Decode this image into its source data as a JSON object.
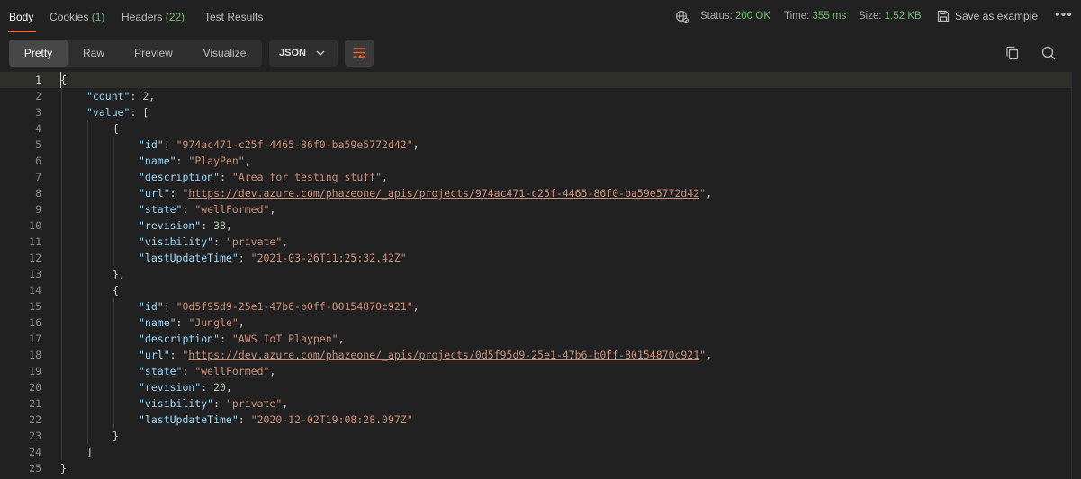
{
  "response_tabs": [
    {
      "label": "Body",
      "count": ""
    },
    {
      "label": "Cookies",
      "count": "(1)"
    },
    {
      "label": "Headers",
      "count": "(22)"
    },
    {
      "label": "Test Results",
      "count": ""
    }
  ],
  "status": {
    "status_label": "Status:",
    "status_value": "200 OK",
    "time_label": "Time:",
    "time_value": "355 ms",
    "size_label": "Size:",
    "size_value": "1.52 KB"
  },
  "save_example_label": "Save as example",
  "view_modes": [
    "Pretty",
    "Raw",
    "Preview",
    "Visualize"
  ],
  "format_select": "JSON",
  "colors": {
    "accent": "#ff6c37",
    "success": "#6fbf73",
    "key": "#9cdcfe",
    "string": "#ce9178",
    "number": "#b5cea8"
  },
  "icons": {
    "network": "globe-icon",
    "save": "save-icon",
    "more": "more-icon",
    "wrap": "wrap-lines-icon",
    "copy": "copy-icon",
    "search": "search-icon",
    "dropdown": "chevron-down-icon"
  },
  "code_lines": [
    {
      "n": "1",
      "ind": 0,
      "tok": [
        [
          "p",
          "{"
        ]
      ]
    },
    {
      "n": "2",
      "ind": 1,
      "tok": [
        [
          "k",
          "\"count\""
        ],
        [
          "p",
          ": "
        ],
        [
          "n",
          "2"
        ],
        [
          "p",
          ","
        ]
      ]
    },
    {
      "n": "3",
      "ind": 1,
      "tok": [
        [
          "k",
          "\"value\""
        ],
        [
          "p",
          ": ["
        ]
      ]
    },
    {
      "n": "4",
      "ind": 2,
      "tok": [
        [
          "p",
          "{"
        ]
      ]
    },
    {
      "n": "5",
      "ind": 3,
      "tok": [
        [
          "k",
          "\"id\""
        ],
        [
          "p",
          ": "
        ],
        [
          "s",
          "\"974ac471-c25f-4465-86f0-ba59e5772d42\""
        ],
        [
          "p",
          ","
        ]
      ]
    },
    {
      "n": "6",
      "ind": 3,
      "tok": [
        [
          "k",
          "\"name\""
        ],
        [
          "p",
          ": "
        ],
        [
          "s",
          "\"PlayPen\""
        ],
        [
          "p",
          ","
        ]
      ]
    },
    {
      "n": "7",
      "ind": 3,
      "tok": [
        [
          "k",
          "\"description\""
        ],
        [
          "p",
          ": "
        ],
        [
          "s",
          "\"Area for testing stuff\""
        ],
        [
          "p",
          ","
        ]
      ]
    },
    {
      "n": "8",
      "ind": 3,
      "tok": [
        [
          "k",
          "\"url\""
        ],
        [
          "p",
          ": "
        ],
        [
          "s",
          "\""
        ],
        [
          "u",
          "https://dev.azure.com/phazeone/_apis/projects/974ac471-c25f-4465-86f0-ba59e5772d42"
        ],
        [
          "s",
          "\""
        ],
        [
          "p",
          ","
        ]
      ]
    },
    {
      "n": "9",
      "ind": 3,
      "tok": [
        [
          "k",
          "\"state\""
        ],
        [
          "p",
          ": "
        ],
        [
          "s",
          "\"wellFormed\""
        ],
        [
          "p",
          ","
        ]
      ]
    },
    {
      "n": "10",
      "ind": 3,
      "tok": [
        [
          "k",
          "\"revision\""
        ],
        [
          "p",
          ": "
        ],
        [
          "n",
          "38"
        ],
        [
          "p",
          ","
        ]
      ]
    },
    {
      "n": "11",
      "ind": 3,
      "tok": [
        [
          "k",
          "\"visibility\""
        ],
        [
          "p",
          ": "
        ],
        [
          "s",
          "\"private\""
        ],
        [
          "p",
          ","
        ]
      ]
    },
    {
      "n": "12",
      "ind": 3,
      "tok": [
        [
          "k",
          "\"lastUpdateTime\""
        ],
        [
          "p",
          ": "
        ],
        [
          "s",
          "\"2021-03-26T11:25:32.42Z\""
        ]
      ]
    },
    {
      "n": "13",
      "ind": 2,
      "tok": [
        [
          "p",
          "},"
        ]
      ]
    },
    {
      "n": "14",
      "ind": 2,
      "tok": [
        [
          "p",
          "{"
        ]
      ]
    },
    {
      "n": "15",
      "ind": 3,
      "tok": [
        [
          "k",
          "\"id\""
        ],
        [
          "p",
          ": "
        ],
        [
          "s",
          "\"0d5f95d9-25e1-47b6-b0ff-80154870c921\""
        ],
        [
          "p",
          ","
        ]
      ]
    },
    {
      "n": "16",
      "ind": 3,
      "tok": [
        [
          "k",
          "\"name\""
        ],
        [
          "p",
          ": "
        ],
        [
          "s",
          "\"Jungle\""
        ],
        [
          "p",
          ","
        ]
      ]
    },
    {
      "n": "17",
      "ind": 3,
      "tok": [
        [
          "k",
          "\"description\""
        ],
        [
          "p",
          ": "
        ],
        [
          "s",
          "\"AWS IoT Playpen\""
        ],
        [
          "p",
          ","
        ]
      ]
    },
    {
      "n": "18",
      "ind": 3,
      "tok": [
        [
          "k",
          "\"url\""
        ],
        [
          "p",
          ": "
        ],
        [
          "s",
          "\""
        ],
        [
          "u",
          "https://dev.azure.com/phazeone/_apis/projects/0d5f95d9-25e1-47b6-b0ff-80154870c921"
        ],
        [
          "s",
          "\""
        ],
        [
          "p",
          ","
        ]
      ]
    },
    {
      "n": "19",
      "ind": 3,
      "tok": [
        [
          "k",
          "\"state\""
        ],
        [
          "p",
          ": "
        ],
        [
          "s",
          "\"wellFormed\""
        ],
        [
          "p",
          ","
        ]
      ]
    },
    {
      "n": "20",
      "ind": 3,
      "tok": [
        [
          "k",
          "\"revision\""
        ],
        [
          "p",
          ": "
        ],
        [
          "n",
          "20"
        ],
        [
          "p",
          ","
        ]
      ]
    },
    {
      "n": "21",
      "ind": 3,
      "tok": [
        [
          "k",
          "\"visibility\""
        ],
        [
          "p",
          ": "
        ],
        [
          "s",
          "\"private\""
        ],
        [
          "p",
          ","
        ]
      ]
    },
    {
      "n": "22",
      "ind": 3,
      "tok": [
        [
          "k",
          "\"lastUpdateTime\""
        ],
        [
          "p",
          ": "
        ],
        [
          "s",
          "\"2020-12-02T19:08:28.097Z\""
        ]
      ]
    },
    {
      "n": "23",
      "ind": 2,
      "tok": [
        [
          "p",
          "}"
        ]
      ]
    },
    {
      "n": "24",
      "ind": 1,
      "tok": [
        [
          "p",
          "]"
        ]
      ]
    },
    {
      "n": "25",
      "ind": 0,
      "tok": [
        [
          "p",
          "}"
        ]
      ]
    }
  ]
}
